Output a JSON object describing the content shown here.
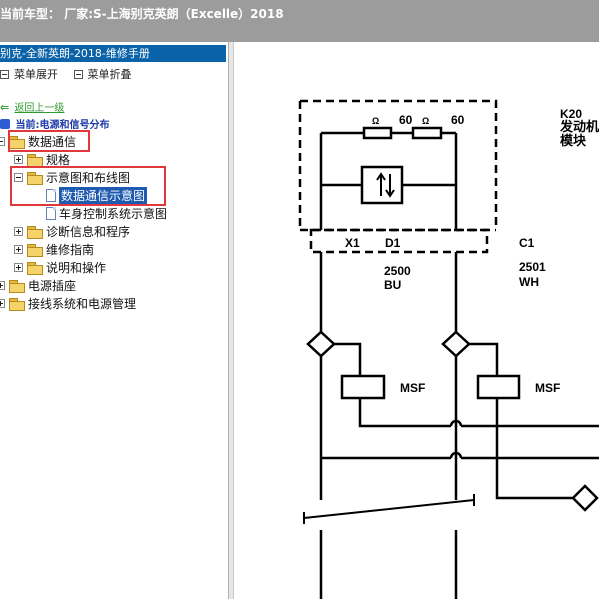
{
  "app": {
    "title_prefix": "当前车型：",
    "title_text": "厂家:S-上海别克英朗（Excelle）2018"
  },
  "sidebar": {
    "header": "别克-全新英朗-2018-维修手册",
    "toolbar": {
      "expand_label": "菜单展开",
      "collapse_label": "菜单折叠"
    },
    "back_label": "返回上一级",
    "current_label": "当前:电源和信号分布",
    "tree": {
      "n0": "数据通信",
      "n1": "规格",
      "n2": "示意图和布线图",
      "n3": "数据通信示意图",
      "n4": "车身控制系统示意图",
      "n5": "诊断信息和程序",
      "n6": "维修指南",
      "n7": "说明和操作",
      "n8": "电源插座",
      "n9": "接线系统和电源管理"
    }
  },
  "diagram": {
    "module_id": "K20",
    "module_name_1": "发动机",
    "module_name_2": "模块",
    "ohm_1": "Ω",
    "res_1": "60",
    "ohm_2": "Ω",
    "res_2": "60",
    "conn_x1": "X1",
    "conn_d1": "D1",
    "conn_c1": "C1",
    "circuit_1": "2500",
    "color_1": "BU",
    "circuit_2": "2501",
    "color_2": "WH",
    "msf_1": "MSF",
    "msf_2": "MSF"
  }
}
